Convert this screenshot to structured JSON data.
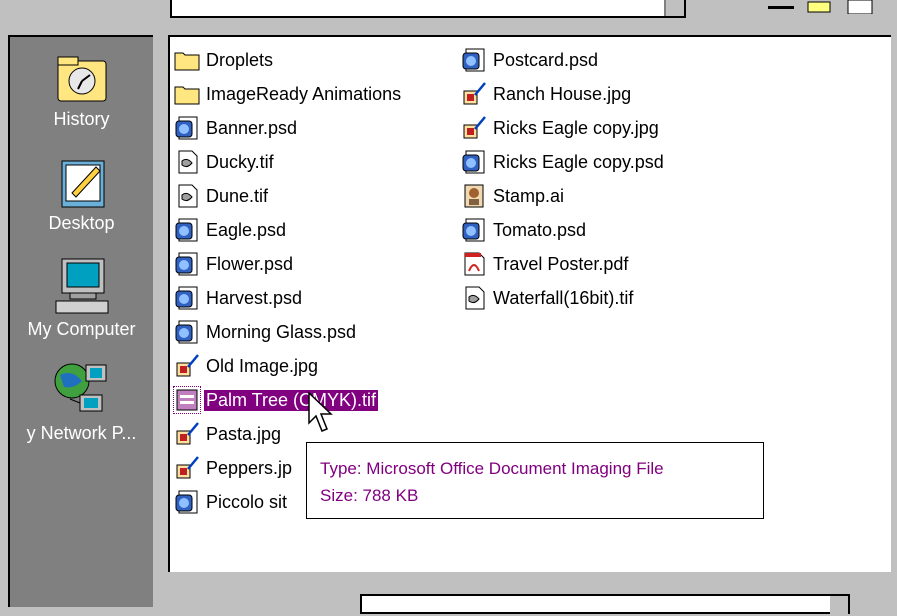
{
  "sidebar": {
    "places": [
      {
        "label": "History",
        "icon": "history-folder-icon"
      },
      {
        "label": "Desktop",
        "icon": "desktop-icon"
      },
      {
        "label": "My Computer",
        "icon": "my-computer-icon"
      },
      {
        "label": "y Network P...",
        "icon": "network-places-icon"
      }
    ]
  },
  "files": {
    "column1": [
      {
        "name": "Droplets",
        "icon": "folder-icon"
      },
      {
        "name": "ImageReady Animations",
        "icon": "folder-icon"
      },
      {
        "name": "Banner.psd",
        "icon": "psd-file-icon"
      },
      {
        "name": "Ducky.tif",
        "icon": "tif-file-icon"
      },
      {
        "name": "Dune.tif",
        "icon": "tif-file-icon"
      },
      {
        "name": "Eagle.psd",
        "icon": "psd-file-icon"
      },
      {
        "name": "Flower.psd",
        "icon": "psd-file-icon"
      },
      {
        "name": "Harvest.psd",
        "icon": "psd-file-icon"
      },
      {
        "name": "Morning Glass.psd",
        "icon": "psd-file-icon"
      },
      {
        "name": "Old Image.jpg",
        "icon": "jpg-file-icon"
      },
      {
        "name": "Palm Tree (CMYK).tif",
        "icon": "mdi-file-icon",
        "selected": true
      },
      {
        "name": "Pasta.jpg",
        "icon": "jpg-file-icon"
      },
      {
        "name": "Peppers.jp",
        "icon": "jpg-file-icon"
      },
      {
        "name": "Piccolo sit",
        "icon": "psd-file-icon"
      }
    ],
    "column2": [
      {
        "name": "Postcard.psd",
        "icon": "psd-file-icon"
      },
      {
        "name": "Ranch House.jpg",
        "icon": "jpg-file-icon"
      },
      {
        "name": "Ricks Eagle copy.jpg",
        "icon": "jpg-file-icon"
      },
      {
        "name": "Ricks Eagle copy.psd",
        "icon": "psd-file-icon"
      },
      {
        "name": "Stamp.ai",
        "icon": "ai-file-icon"
      },
      {
        "name": "Tomato.psd",
        "icon": "psd-file-icon"
      },
      {
        "name": "Travel Poster.pdf",
        "icon": "pdf-file-icon"
      },
      {
        "name": "Waterfall(16bit).tif",
        "icon": "tif-file-icon"
      }
    ]
  },
  "tooltip": {
    "type_line": "Type: Microsoft Office Document Imaging File",
    "size_line": "Size: 788 KB"
  },
  "colors": {
    "selection": "#800080",
    "tooltip_text": "#800080",
    "sidebar_bg": "#808080",
    "window_bg": "#c0c0c0"
  }
}
